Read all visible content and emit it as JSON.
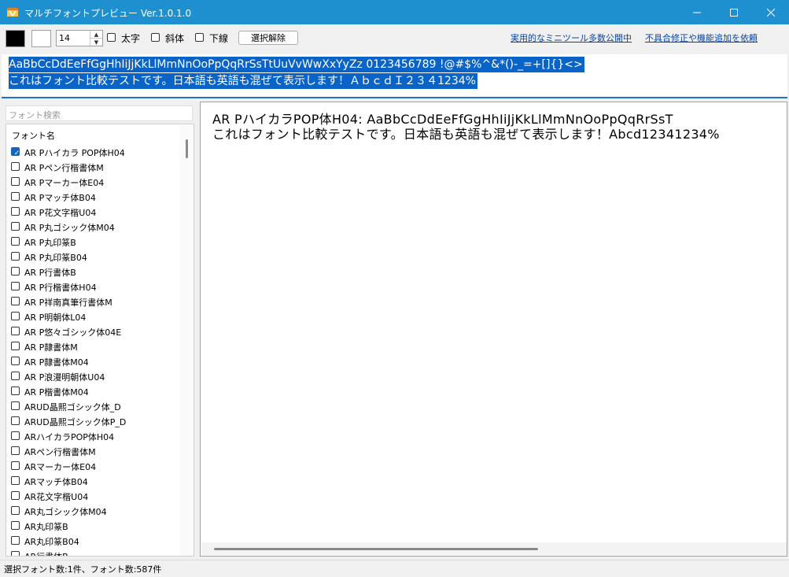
{
  "window": {
    "title": "マルチフォントプレビュー Ver.1.0.1.0",
    "minimize_glyph": "—",
    "maximize_glyph": "☐",
    "close_glyph": "✕",
    "accent_color": "#1e8fcf"
  },
  "toolbar": {
    "font_color": "#000000",
    "background_color": "#ffffff",
    "font_size_value": "14",
    "bold_label": "太字",
    "italic_label": "斜体",
    "underline_label": "下線",
    "bold_checked": false,
    "italic_checked": false,
    "underline_checked": false,
    "clear_selection_label": "選択解除",
    "link_tools": "実用的なミニツール多数公開中",
    "link_request": "不具合修正や機能追加を依頼"
  },
  "sample_text": {
    "line1": "AaBbCcDdEeFfGgHhIiJjKkLlMmNnOoPpQqRrSsTtUuVvWwXxYyZz 0123456789 !@#$%^&*()-_=+[]{}<>",
    "line2": "これはフォント比較テストです。日本語も英語も混ぜて表示します！ＡｂｃｄＩ２３４1234%"
  },
  "font_search": {
    "placeholder": "フォント検索"
  },
  "font_list": {
    "header": "フォント名",
    "items": [
      {
        "name": "AR Pハイカラ POP体H04",
        "checked": true
      },
      {
        "name": "AR Pペン行楷書体M",
        "checked": false
      },
      {
        "name": "AR Pマーカー体E04",
        "checked": false
      },
      {
        "name": "AR Pマッチ体B04",
        "checked": false
      },
      {
        "name": "AR P花文字楷U04",
        "checked": false
      },
      {
        "name": "AR P丸ゴシック体M04",
        "checked": false
      },
      {
        "name": "AR P丸印篆B",
        "checked": false
      },
      {
        "name": "AR P丸印篆B04",
        "checked": false
      },
      {
        "name": "AR P行書体B",
        "checked": false
      },
      {
        "name": "AR P行楷書体H04",
        "checked": false
      },
      {
        "name": "AR P祥南真筆行書体M",
        "checked": false
      },
      {
        "name": "AR P明朝体L04",
        "checked": false
      },
      {
        "name": "AR P悠々ゴシック体04E",
        "checked": false
      },
      {
        "name": "AR P隷書体M",
        "checked": false
      },
      {
        "name": "AR P隷書体M04",
        "checked": false
      },
      {
        "name": "AR P浪漫明朝体U04",
        "checked": false
      },
      {
        "name": "AR P楷書体M04",
        "checked": false
      },
      {
        "name": "ARUD晶熙ゴシック体_D",
        "checked": false
      },
      {
        "name": "ARUD晶熙ゴシック体P_D",
        "checked": false
      },
      {
        "name": "ARハイカラPOP体H04",
        "checked": false
      },
      {
        "name": "ARペン行楷書体M",
        "checked": false
      },
      {
        "name": "ARマーカー体E04",
        "checked": false
      },
      {
        "name": "ARマッチ体B04",
        "checked": false
      },
      {
        "name": "AR花文字楷U04",
        "checked": false
      },
      {
        "name": "AR丸ゴシック体M04",
        "checked": false
      },
      {
        "name": "AR丸印篆B",
        "checked": false
      },
      {
        "name": "AR丸印篆B04",
        "checked": false
      },
      {
        "name": "AR行書体B",
        "checked": false
      }
    ]
  },
  "preview": {
    "line1": "AR PハイカラPOP体H04: AaBbCcDdEeFfGgHhIiJjKkLlMmNnOoPpQqRrSsT",
    "line2": "これはフォント比較テストです。日本語も英語も混ぜて表示します！Abcd12341234%"
  },
  "status": {
    "text": "選択フォント数:1件、フォント数:587件"
  }
}
